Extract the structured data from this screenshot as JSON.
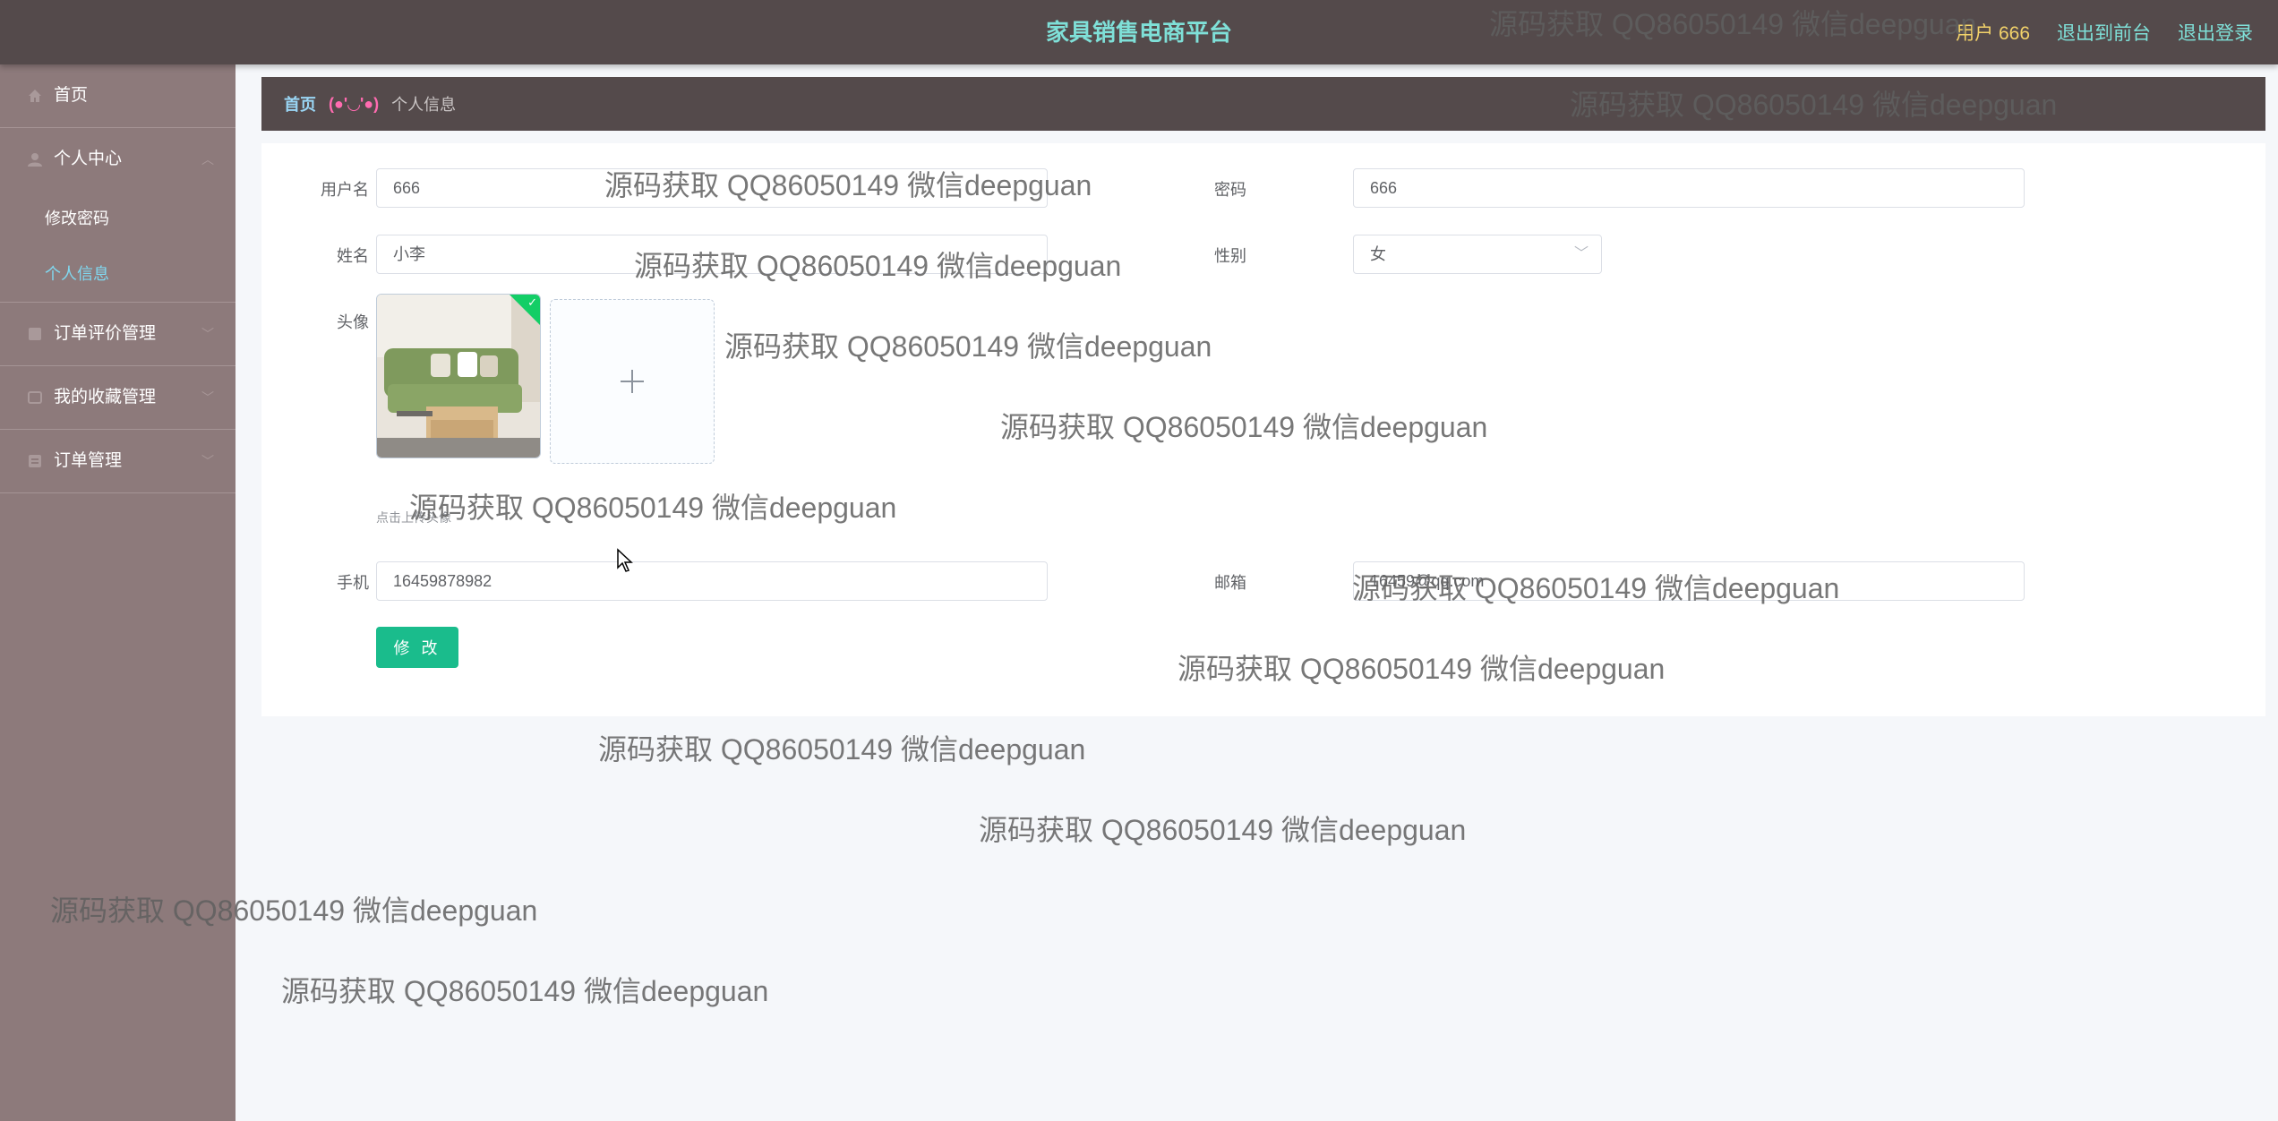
{
  "header": {
    "title": "家具销售电商平台",
    "user_label": "用户 666",
    "back_to_front": "退出到前台",
    "logout": "退出登录"
  },
  "sidebar": {
    "home": "首页",
    "personal_center": "个人中心",
    "change_password": "修改密码",
    "personal_info": "个人信息",
    "order_review": "订单评价管理",
    "favorites": "我的收藏管理",
    "orders": "订单管理"
  },
  "breadcrumb": {
    "home": "首页",
    "emoji": "(●'◡'●)",
    "current": "个人信息"
  },
  "form": {
    "username_label": "用户名",
    "username_value": "666",
    "password_label": "密码",
    "password_value": "666",
    "name_label": "姓名",
    "name_value": "小李",
    "gender_label": "性别",
    "gender_value": "女",
    "avatar_label": "头像",
    "upload_tip": "点击上传头像",
    "phone_label": "手机",
    "phone_value": "16459878982",
    "email_label": "邮箱",
    "email_value": "16459@qq.com",
    "submit_label": "修 改"
  },
  "watermark": "源码获取 QQ86050149 微信deepguan",
  "colors": {
    "topbar": "#544a4b",
    "sidebar": "#8d7a7b",
    "title": "#7fe0d8",
    "user": "#f3d36a",
    "submit": "#1abc8c"
  },
  "icons": [
    "home-icon",
    "user-icon",
    "order-review-icon",
    "favorites-icon",
    "orders-icon",
    "chevron-down-icon",
    "plus-icon",
    "upload-success-icon"
  ]
}
